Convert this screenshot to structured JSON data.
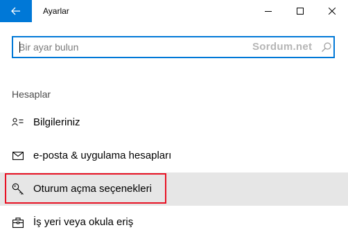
{
  "window": {
    "title": "Ayarlar",
    "accent": "#0078d7"
  },
  "search": {
    "placeholder": "Bir ayar bulun",
    "watermark": "Sordum.net",
    "icon": "search-icon"
  },
  "section": {
    "heading": "Hesaplar"
  },
  "nav_items": [
    {
      "label": "Bilgileriniz",
      "icon": "person-info-icon",
      "selected": false
    },
    {
      "label": "e-posta & uygulama hesapları",
      "icon": "mail-icon",
      "selected": false
    },
    {
      "label": "Oturum açma seçenekleri",
      "icon": "key-icon",
      "selected": true
    },
    {
      "label": "İş yeri veya okula eriş",
      "icon": "briefcase-icon",
      "selected": false
    }
  ],
  "highlight_color": "#e81123"
}
